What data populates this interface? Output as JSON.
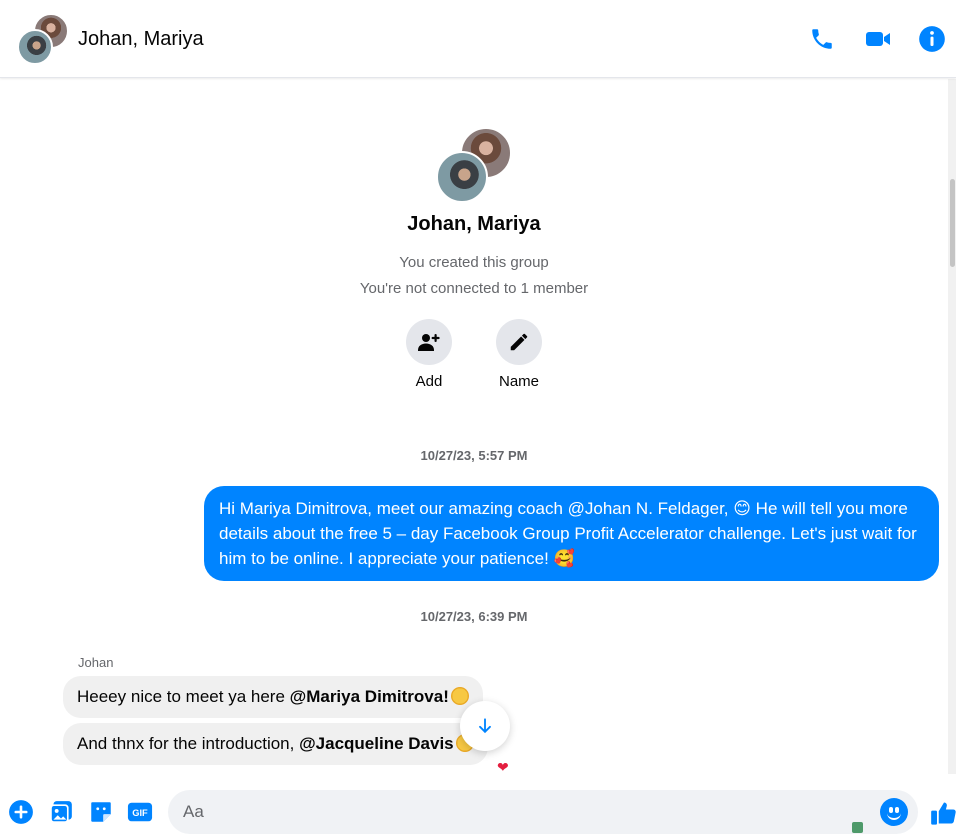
{
  "header": {
    "title": "Johan, Mariya"
  },
  "group": {
    "name": "Johan, Mariya",
    "created_text": "You created this group",
    "connection_text": "You're not connected to 1 member",
    "add_label": "Add",
    "name_label": "Name"
  },
  "messages": {
    "timestamp1": "10/27/23, 5:57 PM",
    "outgoing_text": "Hi Mariya Dimitrova, meet our amazing coach @Johan N. Feldager, 😊 He will tell you more details about the free 5 – day Facebook Group Profit Accelerator challenge. Let's just wait for him to be online. I appreciate your patience! 🥰",
    "timestamp2": "10/27/23, 6:39 PM",
    "sender_name": "Johan",
    "incoming1_prefix": "Heeey nice to meet ya here ",
    "incoming1_mention": "@Mariya Dimitrova!",
    "incoming2_prefix": "And thnx for the introduction, ",
    "incoming2_mention": "@Jacqueline Davis",
    "reaction": "❤"
  },
  "composer": {
    "placeholder": "Aa"
  },
  "colors": {
    "accent": "#0084ff",
    "incoming_bubble": "#f0f0f0",
    "secondary_text": "#65676b"
  }
}
